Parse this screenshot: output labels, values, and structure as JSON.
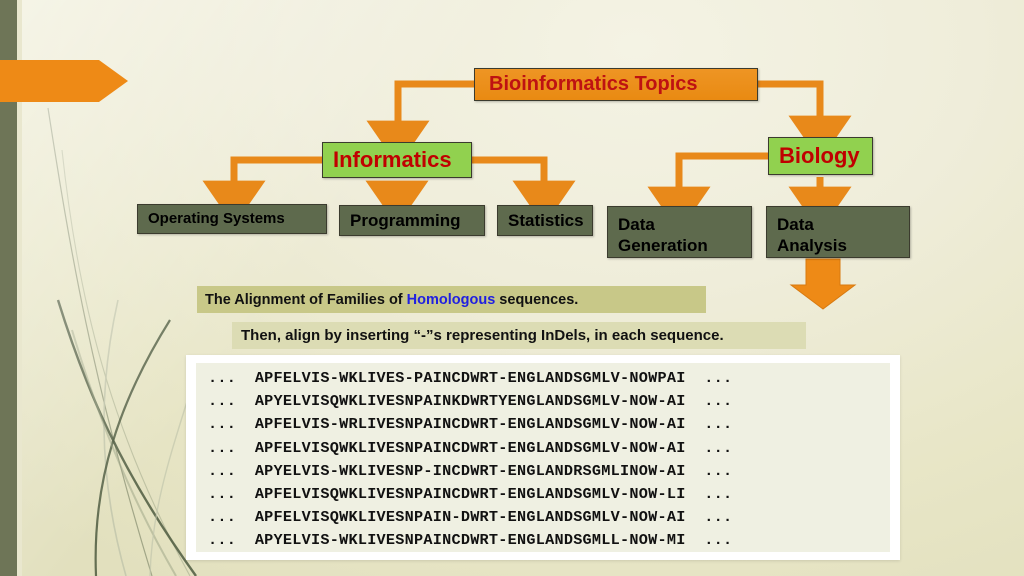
{
  "slide": {
    "title": "Bioinformatics Topics"
  },
  "colors": {
    "background": "#EDEBD0",
    "orange": "#EE8A16",
    "green": "#91D14F",
    "gray": "#5E6A4D",
    "dark_red": "#C00000",
    "stripe_green": "#6E7557",
    "banner_1_bg": "#C8C888",
    "banner_2_bg": "#DCDCB4",
    "link_blue": "#2020E0",
    "panel_bg": "#EFF0E2"
  },
  "diagram": {
    "root": {
      "label": "Bioinformatics Topics"
    },
    "branches": [
      {
        "label": "Informatics",
        "children": [
          {
            "label": "Operating Systems"
          },
          {
            "label": "Programming"
          },
          {
            "label": "Statistics"
          }
        ]
      },
      {
        "label": "Biology",
        "children": [
          {
            "label": "Data\nGeneration"
          },
          {
            "label": "Data\nAnalysis"
          }
        ]
      }
    ]
  },
  "banners": {
    "line1_before": "The Alignment of Families of ",
    "line1_highlight": "Homologous",
    "line1_after": " sequences.",
    "line2": "Then, align by inserting “-”s representing InDels, in each sequence."
  },
  "alignment": {
    "sequences": [
      "...  APFELVIS-WKLIVES-PAINCDWRT-ENGLANDSGMLV-NOWPAI  ...",
      "...  APYELVISQWKLIVESNPAINKDWRTYENGLANDSGMLV-NOW-AI  ...",
      "...  APFELVIS-WRLIVESNPAINCDWRT-ENGLANDSGMLV-NOW-AI  ...",
      "...  APFELVISQWKLIVESNPAINCDWRT-ENGLANDSGMLV-NOW-AI  ...",
      "...  APYELVIS-WKLIVESNP-INCDWRT-ENGLANDRSGMLINOW-AI  ...",
      "...  APFELVISQWKLIVESNPAINCDWRT-ENGLANDSGMLV-NOW-LI  ...",
      "...  APFELVISQWKLIVESNPAIN-DWRT-ENGLANDSGMLV-NOW-AI  ...",
      "...  APYELVIS-WKLIVESNPAINCDWRT-ENGLANDSGMLL-NOW-MI  ..."
    ]
  }
}
